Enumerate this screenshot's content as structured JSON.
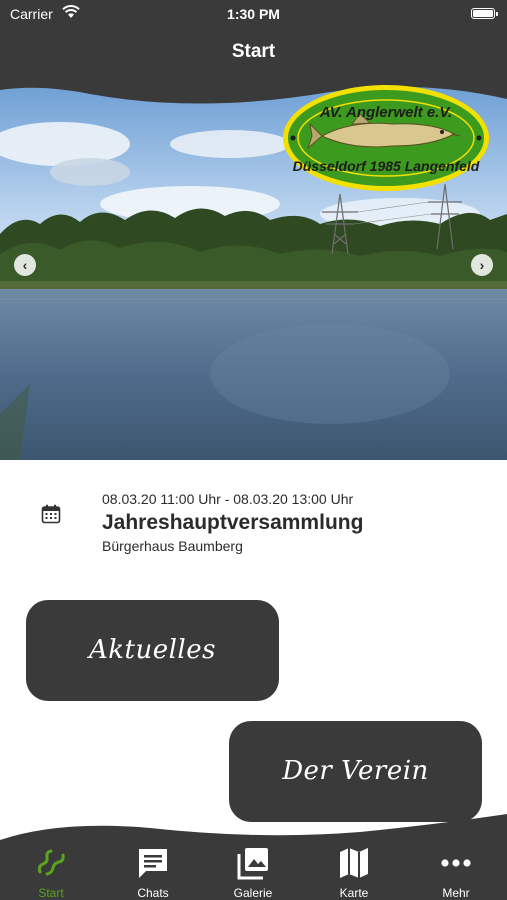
{
  "status_bar": {
    "carrier": "Carrier",
    "time": "1:30 PM"
  },
  "nav": {
    "title": "Start"
  },
  "hero": {
    "logo_line1": "AV. Anglerwelt e.V.",
    "logo_line2": "Düsseldorf 1985 Langenfeld"
  },
  "event": {
    "date": "08.03.20 11:00 Uhr - 08.03.20 13:00 Uhr",
    "title": "Jahreshauptversammlung",
    "location": "Bürgerhaus Baumberg"
  },
  "tiles": {
    "aktuelles": "Aktuelles",
    "verein": "Der Verein"
  },
  "tabs": [
    {
      "label": "Start",
      "icon": "fish-icon",
      "active": true
    },
    {
      "label": "Chats",
      "icon": "chat-icon"
    },
    {
      "label": "Galerie",
      "icon": "gallery-icon"
    },
    {
      "label": "Karte",
      "icon": "map-icon"
    },
    {
      "label": "Mehr",
      "icon": "more-icon"
    }
  ],
  "colors": {
    "bar": "#3a3a3a",
    "active_tab": "#5aa31c",
    "logo_green": "#3c9a1e",
    "logo_yellow": "#f2e000"
  }
}
